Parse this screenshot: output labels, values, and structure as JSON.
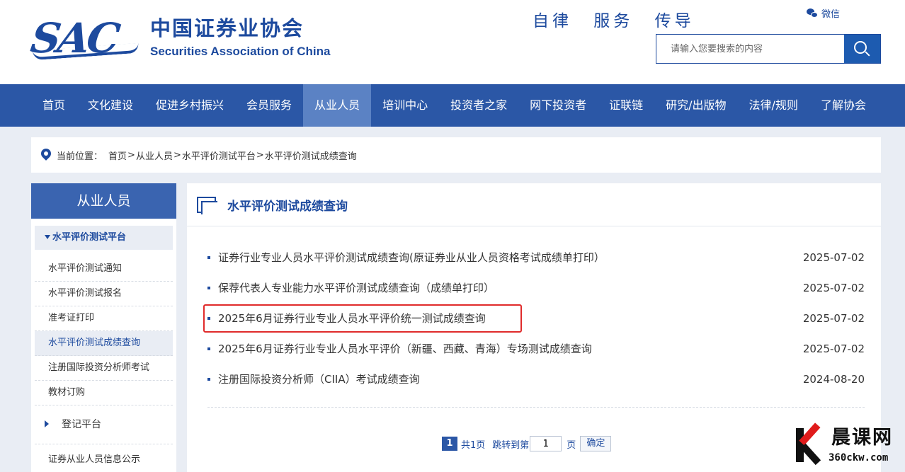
{
  "header": {
    "logo_mark": "SAC",
    "logo_cn": "中国证券业协会",
    "logo_en": "Securities Association of China",
    "slogan": "自律 服务 传导",
    "wechat_label": "微信",
    "search_placeholder": "请输入您要搜索的内容"
  },
  "colors": {
    "brand_blue": "#1d4a9e",
    "nav_bg": "#2b57a6",
    "nav_active": "#5b82c4",
    "highlight_red": "#e02b2b",
    "page_bg": "#e9edf4"
  },
  "nav": {
    "items": [
      {
        "label": "首页"
      },
      {
        "label": "文化建设"
      },
      {
        "label": "促进乡村振兴"
      },
      {
        "label": "会员服务"
      },
      {
        "label": "从业人员",
        "active": true
      },
      {
        "label": "培训中心"
      },
      {
        "label": "投资者之家"
      },
      {
        "label": "网下投资者"
      },
      {
        "label": "证联链"
      },
      {
        "label": "研究/出版物"
      },
      {
        "label": "法律/规则"
      },
      {
        "label": "了解协会"
      }
    ]
  },
  "breadcrumb": {
    "label": "当前位置：",
    "items": [
      "首页",
      "从业人员",
      "水平评价测试平台",
      "水平评价测试成绩查询"
    ],
    "separator": ">"
  },
  "sidebar": {
    "title": "从业人员",
    "group": "水平评价测试平台",
    "items": [
      {
        "label": "水平评价测试通知"
      },
      {
        "label": "水平评价测试报名"
      },
      {
        "label": "准考证打印"
      },
      {
        "label": "水平评价测试成绩查询",
        "current": true
      },
      {
        "label": "注册国际投资分析师考试"
      },
      {
        "label": "教材订购"
      }
    ],
    "platform": "登记平台",
    "info": "证券从业人员信息公示"
  },
  "main": {
    "title": "水平评价测试成绩查询",
    "list": [
      {
        "title": "证券行业专业人员水平评价测试成绩查询(原证券业从业人员资格考试成绩单打印）",
        "date": "2025-07-02"
      },
      {
        "title": "保荐代表人专业能力水平评价测试成绩查询（成绩单打印）",
        "date": "2025-07-02"
      },
      {
        "title": "2025年6月证券行业专业人员水平评价统一测试成绩查询",
        "date": "2025-07-02",
        "highlighted": true
      },
      {
        "title": "2025年6月证券行业专业人员水平评价（新疆、西藏、青海）专场测试成绩查询",
        "date": "2025-07-02"
      },
      {
        "title": "注册国际投资分析师（CIIA）考试成绩查询",
        "date": "2024-08-20"
      }
    ],
    "pager": {
      "current_page": "1",
      "total": "共1页",
      "jump_label": "跳转到第",
      "jump_value": "1",
      "page_unit": "页",
      "confirm": "确定"
    }
  },
  "watermark": {
    "cn": "晨课网",
    "url": "360ckw.com"
  }
}
